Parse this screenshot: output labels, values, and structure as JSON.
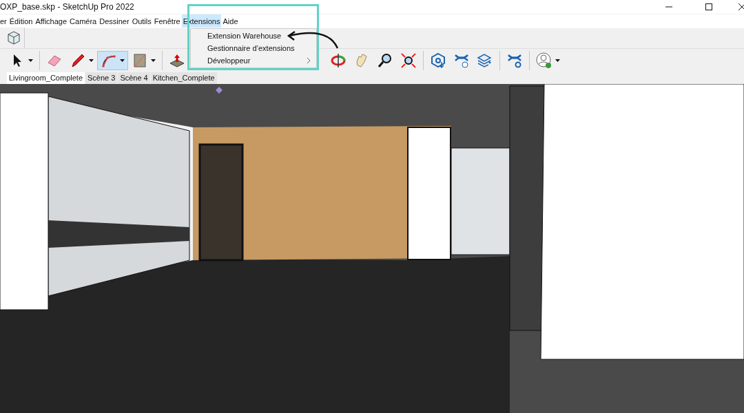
{
  "window": {
    "title": "OXP_base.skp - SketchUp Pro 2022"
  },
  "menu_bar": [
    {
      "label": "er",
      "selected": false
    },
    {
      "label": "Édition",
      "selected": false
    },
    {
      "label": "Affichage",
      "selected": false
    },
    {
      "label": "Caméra",
      "selected": false
    },
    {
      "label": "Dessiner",
      "selected": false
    },
    {
      "label": "Outils",
      "selected": false
    },
    {
      "label": "Fenêtre",
      "selected": false
    },
    {
      "label": "Extensions",
      "selected": true
    },
    {
      "label": "Aide",
      "selected": false
    }
  ],
  "dropdown": [
    {
      "label": "Extension Warehouse",
      "kind": "item"
    },
    {
      "label": "Gestionnaire d’extensions",
      "kind": "item"
    },
    {
      "label": "Développeur",
      "kind": "submenu"
    }
  ],
  "toolbar": [
    {
      "kind": "select",
      "selected": false
    },
    {
      "kind": "eraser",
      "selected": false
    },
    {
      "kind": "pencil",
      "selected": false
    },
    {
      "kind": "arc",
      "selected": true
    },
    {
      "kind": "rectangle",
      "selected": false
    },
    {
      "kind": "pushpull",
      "selected": false
    },
    {
      "kind": "orbit",
      "selected": false
    },
    {
      "kind": "pan",
      "selected": false
    },
    {
      "kind": "zoom",
      "selected": false
    },
    {
      "kind": "zoom-extents",
      "selected": false
    },
    {
      "kind": "warehouse",
      "selected": false
    },
    {
      "kind": "ext-a",
      "selected": false
    },
    {
      "kind": "ext-b",
      "selected": false
    },
    {
      "kind": "ext-c",
      "selected": false
    },
    {
      "kind": "account",
      "selected": false
    }
  ],
  "scene_tabs": [
    {
      "label": "Livingroom_Complete",
      "selected": true
    },
    {
      "label": "Scène 3",
      "selected": false
    },
    {
      "label": "Scène 4",
      "selected": false
    },
    {
      "label": "Kitchen_Complete",
      "selected": false
    }
  ]
}
